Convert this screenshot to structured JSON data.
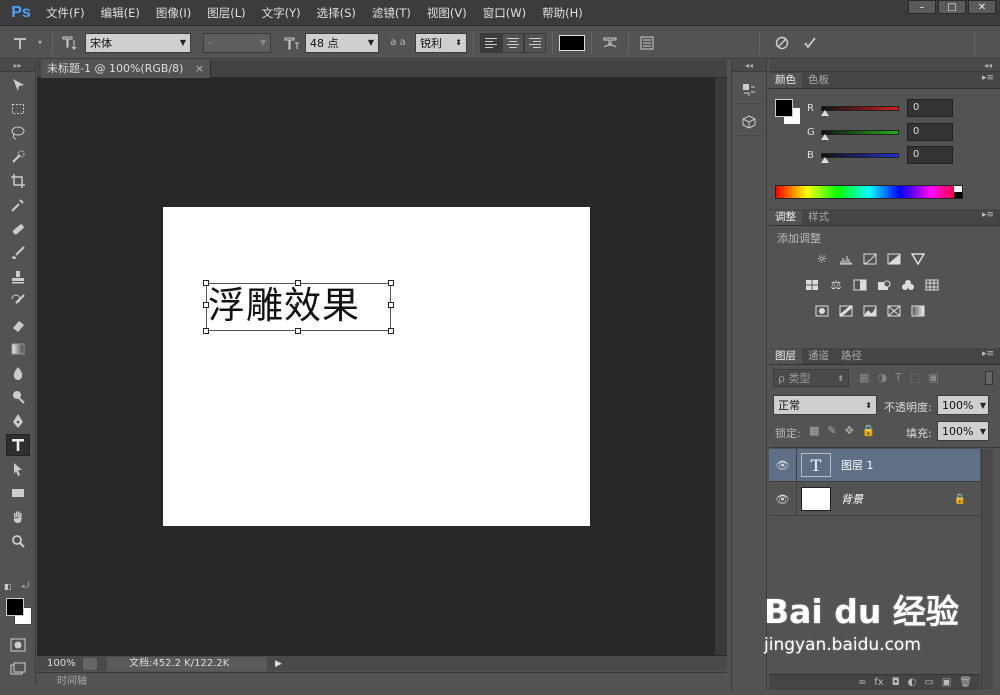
{
  "app": {
    "logo": "Ps",
    "menu": [
      "文件(F)",
      "编辑(E)",
      "图像(I)",
      "图层(L)",
      "文字(Y)",
      "选择(S)",
      "滤镜(T)",
      "视图(V)",
      "窗口(W)",
      "帮助(H)"
    ],
    "window_controls": [
      "–",
      "□",
      "✕"
    ]
  },
  "options": {
    "font_family": "宋体",
    "font_style": "-",
    "font_size": "48 点",
    "aa_label": "a a",
    "antialias": "锐利",
    "text_color": "#000000",
    "cancel_icon": "cancel-icon",
    "commit_icon": "commit-icon"
  },
  "document": {
    "tab_title": "未标题-1 @ 100%(RGB/8)",
    "tab_close": "×",
    "canvas_text": "浮雕效果",
    "zoom": "100%",
    "doc_info": "文档:452.2 K/122.2K",
    "timeline_label": "时间轴"
  },
  "color_panel": {
    "tabs": [
      "颜色",
      "色板"
    ],
    "foreground": "#000000",
    "background": "#ffffff",
    "channels": [
      {
        "label": "R",
        "value": "0",
        "color": "#d02020"
      },
      {
        "label": "G",
        "value": "0",
        "color": "#20b020"
      },
      {
        "label": "B",
        "value": "0",
        "color": "#2030d0"
      }
    ]
  },
  "adjust_panel": {
    "tabs": [
      "调整",
      "样式"
    ],
    "add_label": "添加调整"
  },
  "layers_panel": {
    "tabs": [
      "图层",
      "通道",
      "路径"
    ],
    "filter_label": "ρ 类型",
    "blend_mode": "正常",
    "opacity_label": "不透明度:",
    "opacity_value": "100%",
    "lock_label": "锁定:",
    "fill_label": "填充:",
    "fill_value": "100%",
    "layers": [
      {
        "name": "图层 1",
        "thumb": "T",
        "selected": true
      },
      {
        "name": "背景",
        "thumb": "",
        "selected": false
      }
    ],
    "footer_icons": [
      "∞",
      "fx",
      "◘",
      "◐",
      "▭",
      "▣",
      "🗑"
    ]
  },
  "watermark": {
    "brand": "Bai du 经验",
    "url": "jingyan.baidu.com"
  }
}
